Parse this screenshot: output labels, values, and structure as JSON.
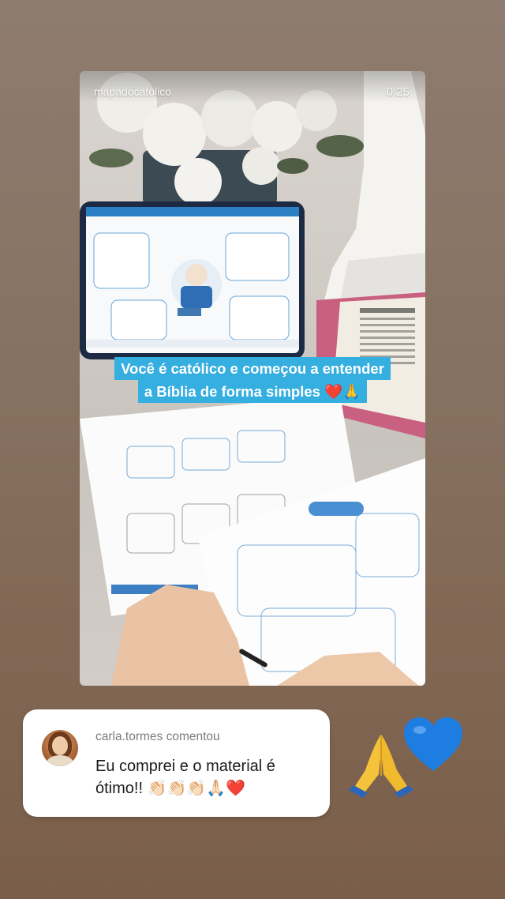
{
  "story": {
    "username": "mapadocatolico",
    "time_remaining": "0:25",
    "caption_line1": "Você é católico e começou a entender",
    "caption_line2": "a Bíblia de forma simples ❤️🙏"
  },
  "comment": {
    "author_line": "carla.tormes comentou",
    "text": "Eu comprei e o material é ótimo!! 👏🏻👏🏻👏🏻🙏🏻❤️"
  },
  "stickers": [
    "pray-hands-emoji",
    "blue-heart-emoji"
  ],
  "colors": {
    "caption_bg": "#35aee0",
    "heart": "#1e7de0"
  }
}
